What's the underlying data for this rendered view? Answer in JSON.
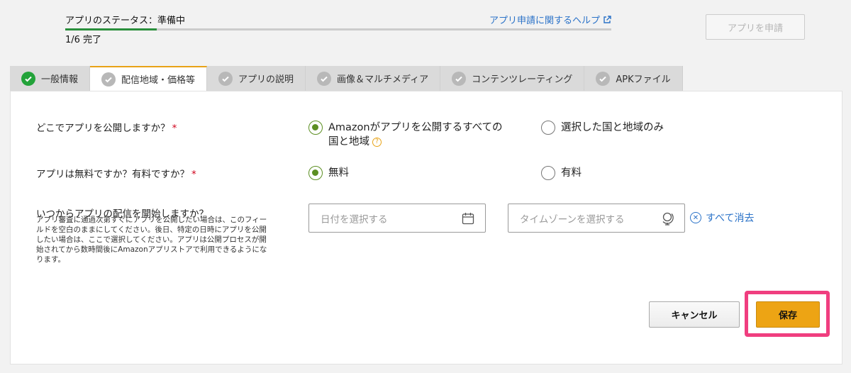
{
  "status": {
    "label": "アプリのステータス：準備中",
    "count": "1/6 完了",
    "progress": 0.167,
    "help_link": "アプリ申請に関するヘルプ"
  },
  "submit_button": "アプリを申請",
  "tabs": [
    {
      "label": "一般情報",
      "state": "done"
    },
    {
      "label": "配信地域・価格等",
      "state": "active"
    },
    {
      "label": "アプリの説明",
      "state": "pending"
    },
    {
      "label": "画像＆マルチメディア",
      "state": "pending"
    },
    {
      "label": "コンテンツレーティング",
      "state": "pending"
    },
    {
      "label": "APKファイル",
      "state": "pending"
    }
  ],
  "form": {
    "q1": {
      "label": "どこでアプリを公開しますか？",
      "required_mark": "*",
      "option_all_line1": "Amazonがアプリを公開するすべての",
      "option_all_line2": "国と地域",
      "option_selected": "選択した国と地域のみ",
      "selected": "all"
    },
    "q2": {
      "label": "アプリは無料ですか？有料ですか？",
      "required_mark": "*",
      "option_free": "無料",
      "option_paid": "有料",
      "selected": "free"
    },
    "q3": {
      "label": "いつからアプリの配信を開始しますか？",
      "description": "アプリ審査に通過次第すぐにアプリを公開したい場合は、このフィールドを空白のままにしてください。後日、特定の日時にアプリを公開したい場合は、ここで選択してください。アプリは公開プロセスが開始されてから数時間後にAmazonアプリストアで利用できるようになります。",
      "date_placeholder": "日付を選択する",
      "timezone_placeholder": "タイムゾーンを選択する",
      "clear_all": "すべて消去"
    }
  },
  "buttons": {
    "cancel": "キャンセル",
    "save": "保存"
  },
  "colors": {
    "accent_tab": "#e8a317",
    "progress": "#2a8f3c",
    "radio_selected": "#5c8f22",
    "link": "#2a72c8",
    "save": "#eda414",
    "highlight": "#f03e7f"
  }
}
